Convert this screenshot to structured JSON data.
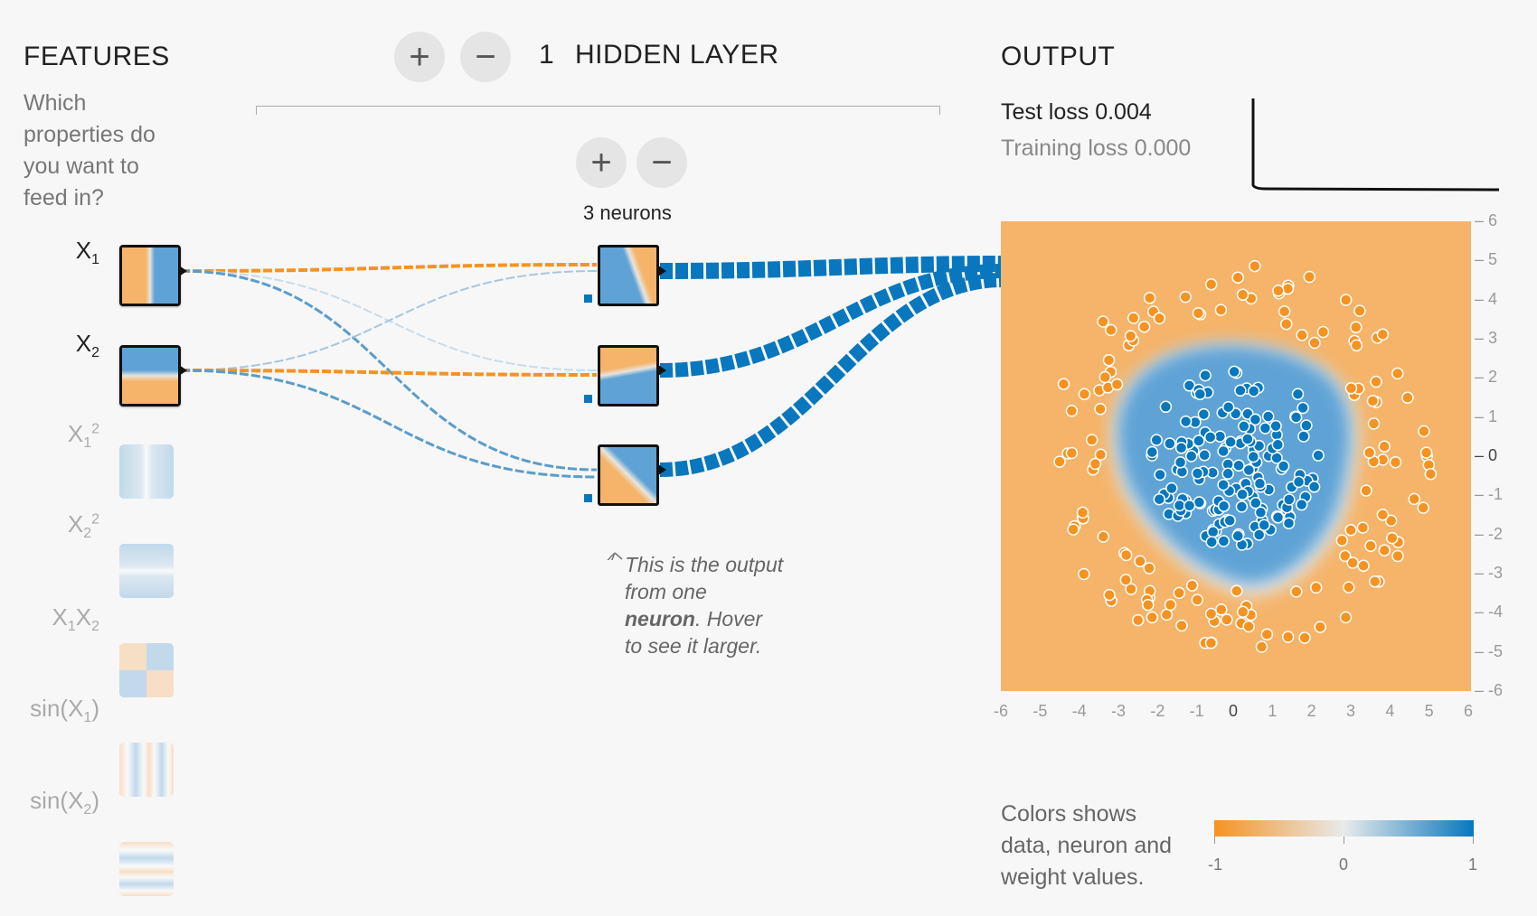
{
  "features": {
    "title": "FEATURES",
    "description": "Which properties do you want to feed in?",
    "items": [
      {
        "base": "X",
        "sub": "1",
        "sup": "",
        "base2": "",
        "sub2": "",
        "tail": "",
        "active": true
      },
      {
        "base": "X",
        "sub": "2",
        "sup": "",
        "base2": "",
        "sub2": "",
        "tail": "",
        "active": true
      },
      {
        "base": "X",
        "sub": "1",
        "sup": "2",
        "base2": "",
        "sub2": "",
        "tail": "",
        "active": false
      },
      {
        "base": "X",
        "sub": "2",
        "sup": "2",
        "base2": "",
        "sub2": "",
        "tail": "",
        "active": false
      },
      {
        "base": "X",
        "sub": "1",
        "sup": "",
        "base2": "X",
        "sub2": "2",
        "tail": "",
        "active": false
      },
      {
        "base": "sin(X",
        "sub": "1",
        "sup": "",
        "base2": "",
        "sub2": "",
        "tail": ")",
        "active": false
      },
      {
        "base": "sin(X",
        "sub": "2",
        "sup": "",
        "base2": "",
        "sub2": "",
        "tail": ")",
        "active": false
      }
    ]
  },
  "hidden": {
    "count": "1",
    "label": "HIDDEN LAYER",
    "add_layer_symbol": "+",
    "remove_layer_symbol": "−",
    "add_neuron_symbol": "+",
    "remove_neuron_symbol": "−",
    "neurons_label": "3 neurons"
  },
  "annotation": {
    "line1": "This is the output",
    "line2": "from one",
    "bold": "neuron",
    "line3_rest": ". Hover",
    "line4": "to see it larger."
  },
  "output": {
    "title": "OUTPUT",
    "test_loss": "Test loss 0.004",
    "training_loss": "Training loss 0.000",
    "x_ticks": [
      "-6",
      "-5",
      "-4",
      "-3",
      "-2",
      "-1",
      "0",
      "1",
      "2",
      "3",
      "4",
      "5",
      "6"
    ],
    "y_ticks": [
      "6",
      "5",
      "4",
      "3",
      "2",
      "1",
      "0",
      "-1",
      "-2",
      "-3",
      "-4",
      "-5",
      "-6"
    ]
  },
  "legend": {
    "text_line1": "Colors shows",
    "text_line2": "data, neuron and",
    "text_line3": "weight values.",
    "min": "-1",
    "mid": "0",
    "max": "1"
  },
  "colors": {
    "orange": "#f59322",
    "blue": "#0877bd",
    "bg_orange": "#f5b46a",
    "bg_blue": "#5fa3d6"
  }
}
